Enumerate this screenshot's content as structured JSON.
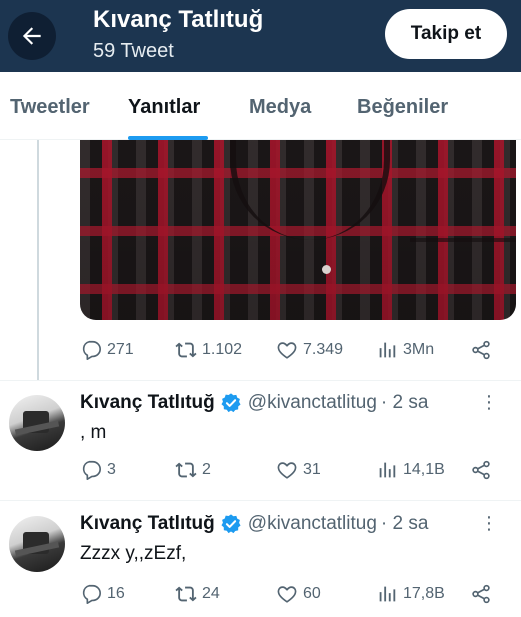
{
  "header": {
    "title": "Kıvanç Tatlıtuğ",
    "subtitle": "59 Tweet",
    "follow_label": "Takip et",
    "back_icon": "arrow-left-icon",
    "background": "#1c3550"
  },
  "tabs": [
    {
      "label": "Tweetler",
      "active": false
    },
    {
      "label": "Yanıtlar",
      "active": true
    },
    {
      "label": "Medya",
      "active": false
    },
    {
      "label": "Beğeniler",
      "active": false
    }
  ],
  "photo_tweet": {
    "replies": "271",
    "retweets": "1.102",
    "likes": "7.349",
    "views": "3Mn"
  },
  "tweets": [
    {
      "name": "Kıvanç Tatlıtuğ",
      "handle": "@kivanctatlitug",
      "time": "· 2 sa",
      "text": ", m",
      "replies": "3",
      "retweets": "2",
      "likes": "31",
      "views": "14,1B"
    },
    {
      "name": "Kıvanç Tatlıtuğ",
      "handle": "@kivanctatlitug",
      "time": "· 2 sa",
      "text": "Zzzx y,,zEzf,",
      "replies": "16",
      "retweets": "24",
      "likes": "60",
      "views": "17,8B"
    }
  ],
  "colors": {
    "accent": "#1d9bf0",
    "secondary_text": "#536471",
    "verified": "#1d9bf0"
  }
}
